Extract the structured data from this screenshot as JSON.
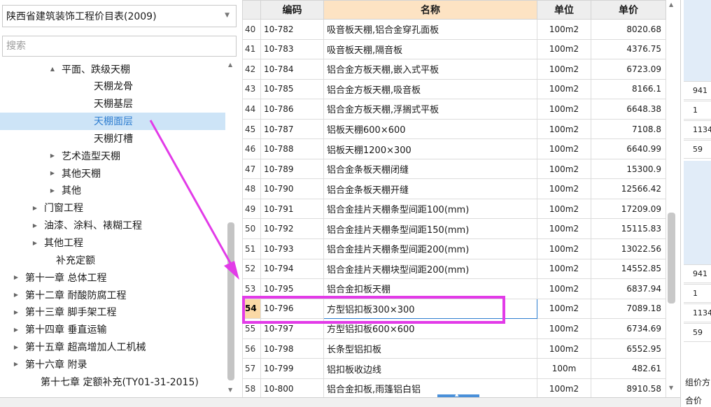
{
  "library_select": {
    "value": "陕西省建筑装饰工程价目表(2009)"
  },
  "search": {
    "placeholder": "搜索"
  },
  "tree": [
    {
      "label": "平面、跌级天棚",
      "expander": "▲"
    },
    {
      "label": "天棚龙骨",
      "expander": ""
    },
    {
      "label": "天棚基层",
      "expander": ""
    },
    {
      "label": "天棚面层",
      "expander": "",
      "selected": true
    },
    {
      "label": "天棚灯槽",
      "expander": ""
    },
    {
      "label": "艺术造型天棚",
      "expander": "▶"
    },
    {
      "label": "其他天棚",
      "expander": "▶"
    },
    {
      "label": "其他",
      "expander": "▶"
    },
    {
      "label": "门窗工程",
      "expander": "▶"
    },
    {
      "label": "油漆、涂料、裱糊工程",
      "expander": "▶"
    },
    {
      "label": "其他工程",
      "expander": "▶"
    },
    {
      "label": "补充定额",
      "expander": ""
    },
    {
      "label": "第十一章 总体工程",
      "expander": "▶"
    },
    {
      "label": "第十二章 耐酸防腐工程",
      "expander": "▶"
    },
    {
      "label": "第十三章 脚手架工程",
      "expander": "▶"
    },
    {
      "label": "第十四章 垂直运输",
      "expander": "▶"
    },
    {
      "label": "第十五章 超高增加人工机械",
      "expander": "▶"
    },
    {
      "label": "第十六章 附录",
      "expander": "▶"
    },
    {
      "label": "第十七章 定额补充(TY01-31-2015)",
      "expander": ""
    }
  ],
  "grid": {
    "headers": {
      "code": "编码",
      "name": "名称",
      "unit": "单位",
      "price": "单价"
    },
    "rows": [
      {
        "no": "40",
        "code": "10-782",
        "name": "吸音板天棚,铝合金穿孔面板",
        "unit": "100m2",
        "price": "8020.68"
      },
      {
        "no": "41",
        "code": "10-783",
        "name": "吸音板天棚,隔音板",
        "unit": "100m2",
        "price": "4376.75"
      },
      {
        "no": "42",
        "code": "10-784",
        "name": "铝合金方板天棚,嵌入式平板",
        "unit": "100m2",
        "price": "6723.09"
      },
      {
        "no": "43",
        "code": "10-785",
        "name": "铝合金方板天棚,吸音板",
        "unit": "100m2",
        "price": "8166.1"
      },
      {
        "no": "44",
        "code": "10-786",
        "name": "铝合金方板天棚,浮搁式平板",
        "unit": "100m2",
        "price": "6648.38"
      },
      {
        "no": "45",
        "code": "10-787",
        "name": "铝板天棚600×600",
        "unit": "100m2",
        "price": "7108.8"
      },
      {
        "no": "46",
        "code": "10-788",
        "name": "铝板天棚1200×300",
        "unit": "100m2",
        "price": "6640.99"
      },
      {
        "no": "47",
        "code": "10-789",
        "name": "铝合金条板天棚闭缝",
        "unit": "100m2",
        "price": "15300.9"
      },
      {
        "no": "48",
        "code": "10-790",
        "name": "铝合金条板天棚开缝",
        "unit": "100m2",
        "price": "12566.42"
      },
      {
        "no": "49",
        "code": "10-791",
        "name": "铝合金挂片天棚条型间距100(mm)",
        "unit": "100m2",
        "price": "17209.09"
      },
      {
        "no": "50",
        "code": "10-792",
        "name": "铝合金挂片天棚条型间距150(mm)",
        "unit": "100m2",
        "price": "15115.83"
      },
      {
        "no": "51",
        "code": "10-793",
        "name": "铝合金挂片天棚条型间距200(mm)",
        "unit": "100m2",
        "price": "13022.56"
      },
      {
        "no": "52",
        "code": "10-794",
        "name": "铝合金挂片天棚块型间距200(mm)",
        "unit": "100m2",
        "price": "14552.85"
      },
      {
        "no": "53",
        "code": "10-795",
        "name": "铝合金扣板天棚",
        "unit": "100m2",
        "price": "6837.94"
      },
      {
        "no": "54",
        "code": "10-796",
        "name": "方型铝扣板300×300",
        "unit": "100m2",
        "price": "7089.18",
        "current": true
      },
      {
        "no": "55",
        "code": "10-797",
        "name": "方型铝扣板600×600",
        "unit": "100m2",
        "price": "6734.69"
      },
      {
        "no": "56",
        "code": "10-798",
        "name": "长条型铝扣板",
        "unit": "100m2",
        "price": "6552.95"
      },
      {
        "no": "57",
        "code": "10-799",
        "name": "铝扣板收边线",
        "unit": "100m",
        "price": "482.61"
      },
      {
        "no": "58",
        "code": "10-800",
        "name": "铝合金扣板,雨篷铝白铝",
        "unit": "100m2",
        "price": "8910.58"
      }
    ]
  },
  "right_pane": {
    "cells": [
      "941",
      "1",
      "1134",
      "59",
      "941",
      "1",
      "1134",
      "59"
    ],
    "labels": [
      "组价方",
      "合价"
    ]
  },
  "annotation": {
    "color": "#e23be8"
  }
}
